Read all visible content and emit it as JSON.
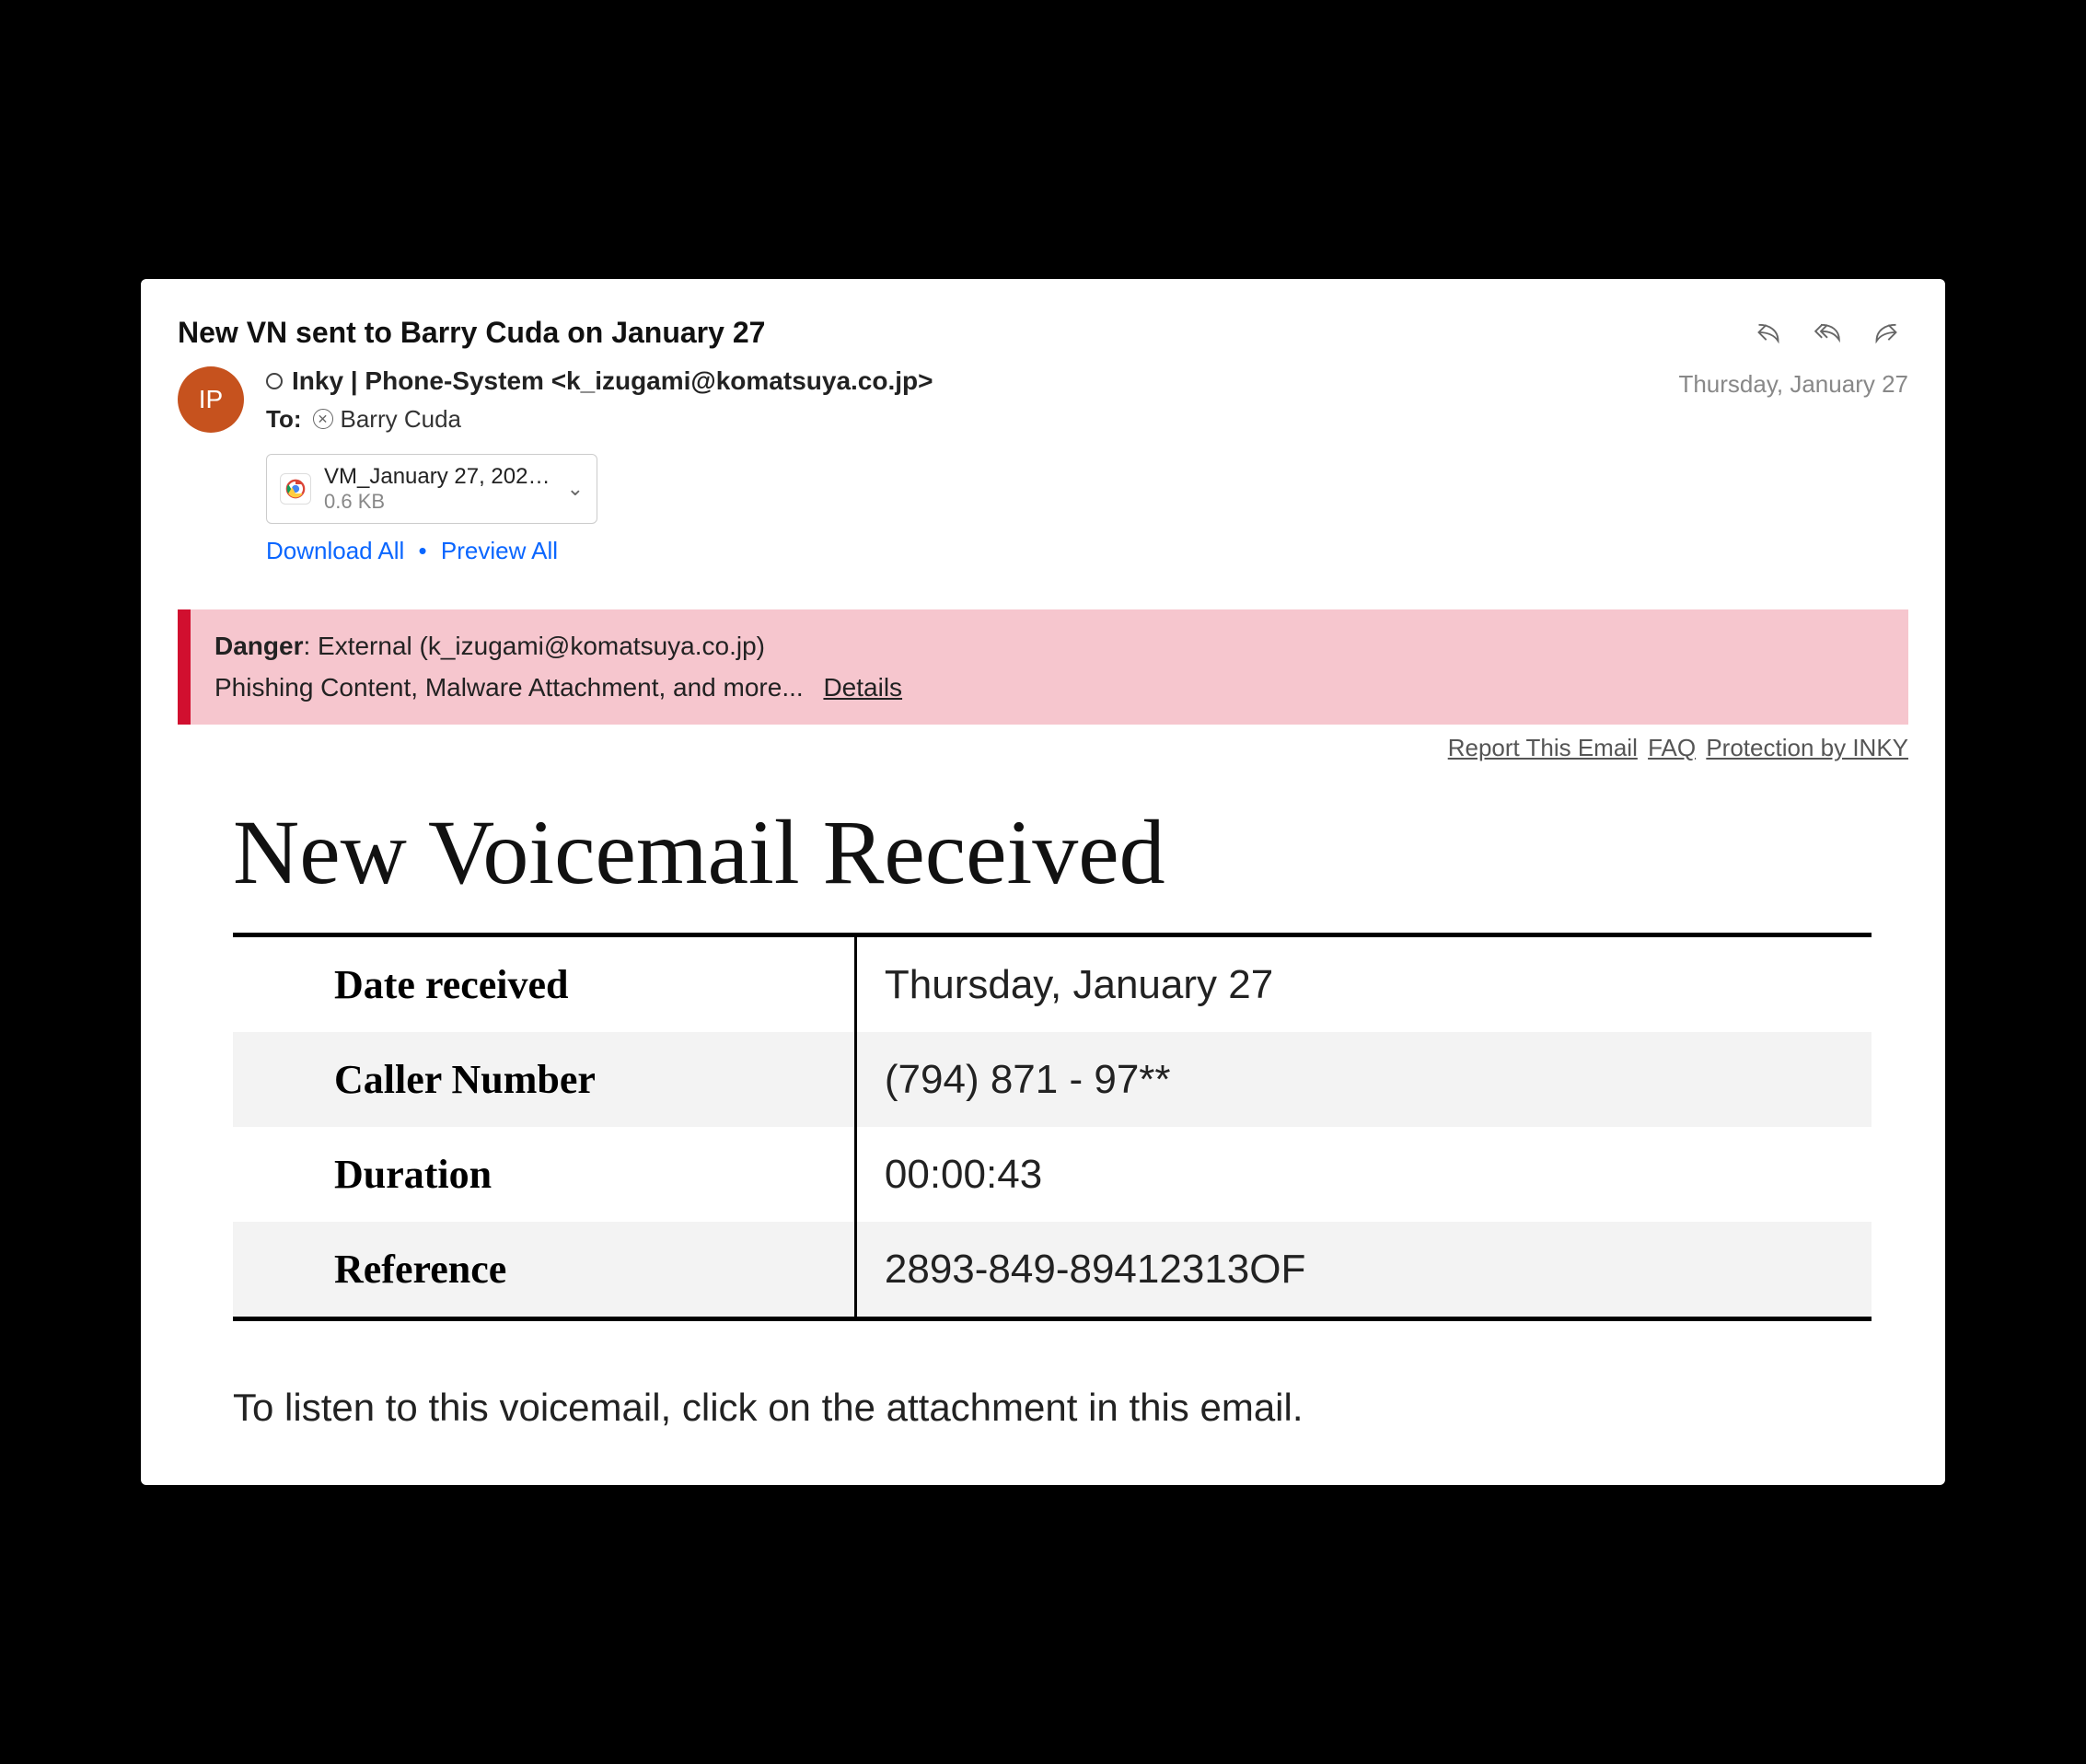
{
  "header": {
    "subject": "New VN sent to Barry Cuda on January 27",
    "date": "Thursday, January 27",
    "from_display": "Inky | Phone-System <k_izugami@komatsuya.co.jp>",
    "to_label": "To:",
    "to_name": "Barry Cuda",
    "avatar_initials": "IP"
  },
  "attachment": {
    "name": "VM_January 27, 202…",
    "size": "0.6 KB",
    "download_all": "Download All",
    "preview_all": "Preview All"
  },
  "banner": {
    "danger_label": "Danger",
    "external_text": ": External (k_izugami@komatsuya.co.jp)",
    "line2": "Phishing Content, Malware Attachment, and more...",
    "details": "Details"
  },
  "inky_links": {
    "report": "Report This Email",
    "faq": "FAQ",
    "protection": "Protection by INKY"
  },
  "body": {
    "title": "New Voicemail Received",
    "rows": [
      {
        "k": "Date received",
        "v": "Thursday, January 27"
      },
      {
        "k": "Caller Number",
        "v": "(794) 871 - 97**"
      },
      {
        "k": "Duration",
        "v": "00:00:43"
      },
      {
        "k": "Reference",
        "v": "2893-849-89412313OF"
      }
    ],
    "note": "To listen to this voicemail, click on the attachment in this email."
  }
}
